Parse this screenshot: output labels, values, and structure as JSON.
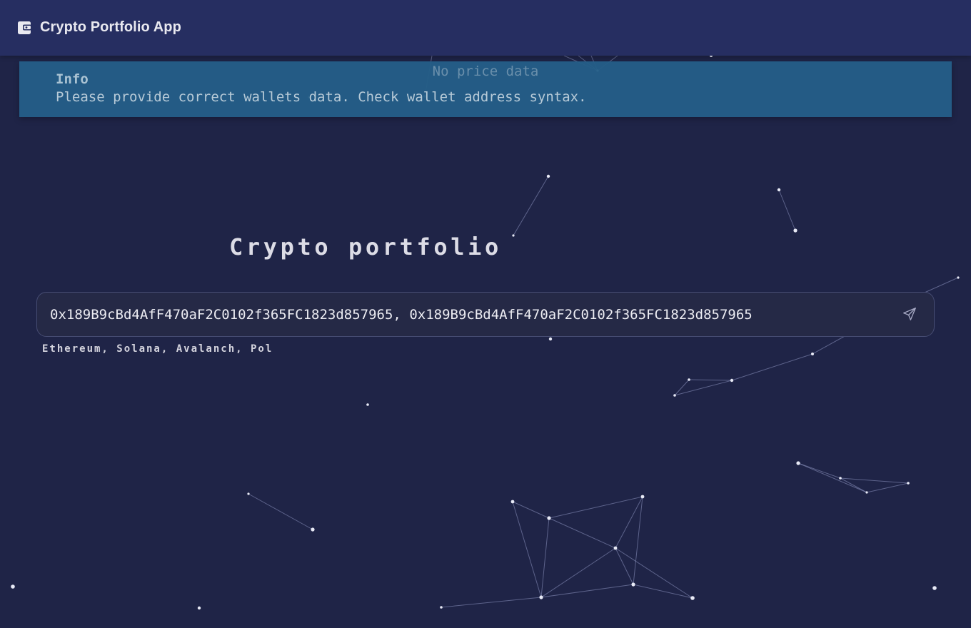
{
  "app": {
    "title": "Crypto Portfolio App",
    "icon": "wallet-icon"
  },
  "alert": {
    "severity": "info",
    "title": "Info",
    "message": "Please provide correct wallets data. Check wallet address syntax.",
    "color": "#245e87"
  },
  "background_status": "No price data",
  "main": {
    "title": "Crypto portfolio",
    "wallet_input": {
      "value": "0x189B9cBd4AfF470aF2C0102f365FC1823d857965, 0x189B9cBd4AfF470aF2C0102f365FC1823d857965",
      "placeholder": ""
    },
    "send_icon": "send-icon",
    "helper_text": "Ethereum, Solana, Avalanch, Pol"
  },
  "colors": {
    "background": "#1f2447",
    "appbar": "#262e61",
    "field_background": "#252946",
    "field_border": "#464c72"
  }
}
